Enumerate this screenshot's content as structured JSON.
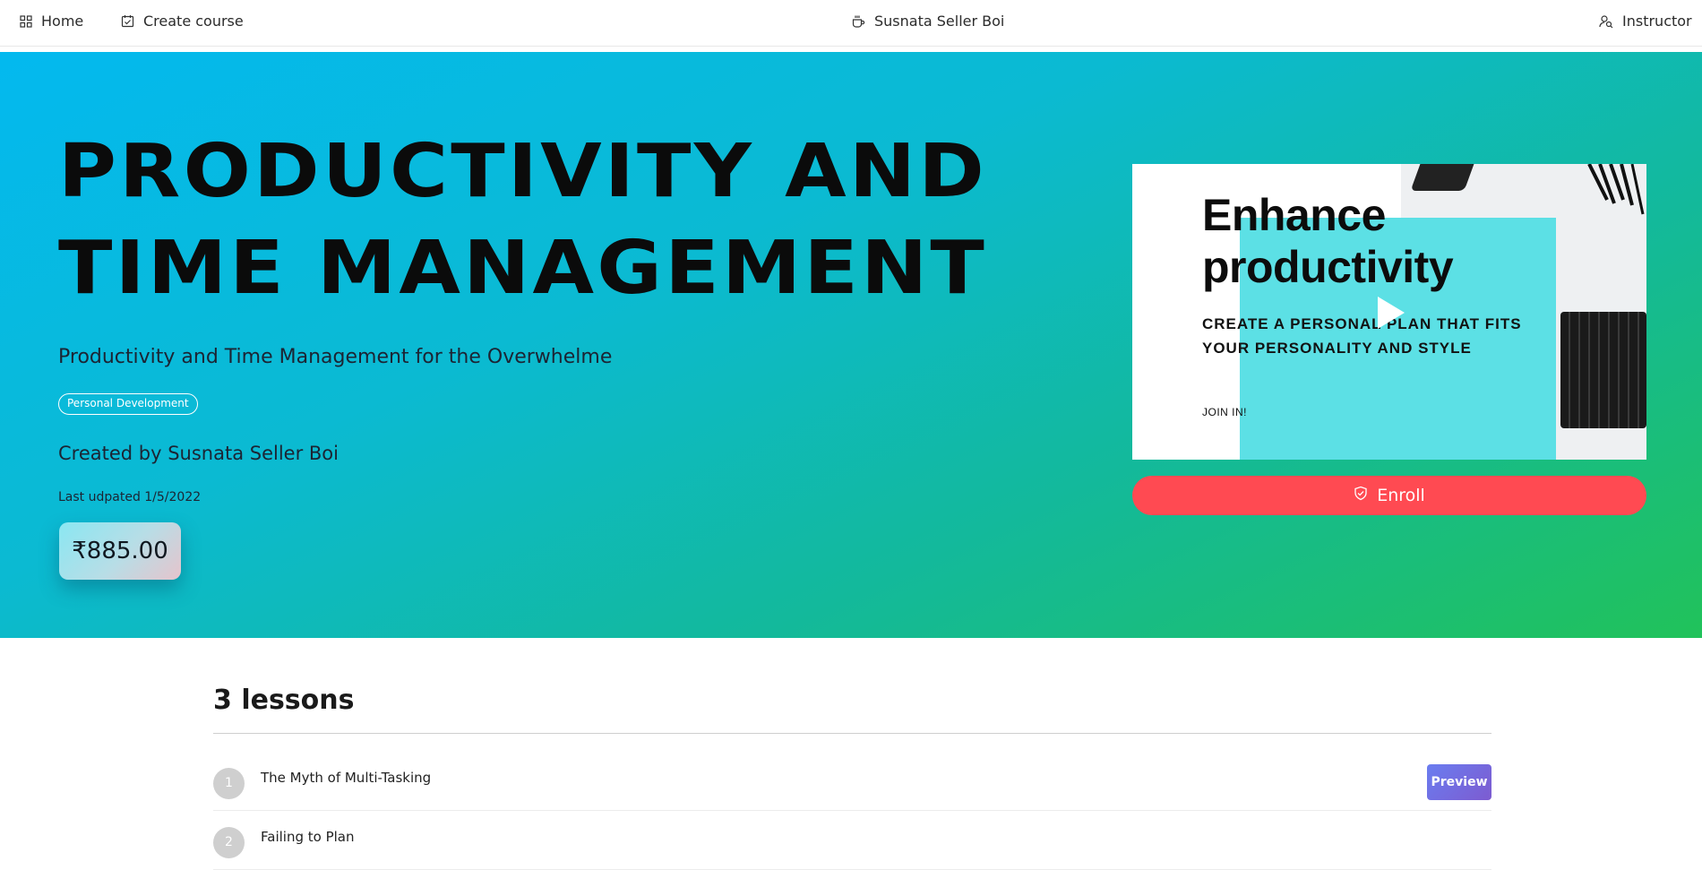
{
  "nav": {
    "home_label": "Home",
    "create_course_label": "Create course",
    "seller_label": "Susnata Seller Boi",
    "instructor_label": "Instructor"
  },
  "course": {
    "title": "PRODUCTIVITY AND TIME MANAGEMENT",
    "subtitle": "Productivity and Time Management for the Overwhelme",
    "category": "Personal Development",
    "created_by": "Created by Susnata Seller Boi",
    "last_updated": "Last udpated 1/5/2022",
    "price": "₹885.00"
  },
  "preview_image": {
    "heading_line1": "Enhance",
    "heading_line2": "productivity",
    "tagline_line1": "CREATE A PERSONAL PLAN THAT FITS",
    "tagline_line2": "YOUR PERSONALITY AND STYLE",
    "join_text": "JOIN IN!",
    "accent_color": "#5ce0e5"
  },
  "enroll": {
    "label": "Enroll",
    "color": "#ff4a52"
  },
  "lessons": {
    "heading": "3 lessons",
    "items": [
      {
        "number": "1",
        "title": "The Myth of Multi-Tasking",
        "preview_label": "Preview"
      },
      {
        "number": "2",
        "title": "Failing to Plan"
      }
    ]
  },
  "colors": {
    "hero_gradient_start": "#03b9ef",
    "hero_gradient_end": "#21c25a",
    "preview_button": "#7468e0"
  }
}
